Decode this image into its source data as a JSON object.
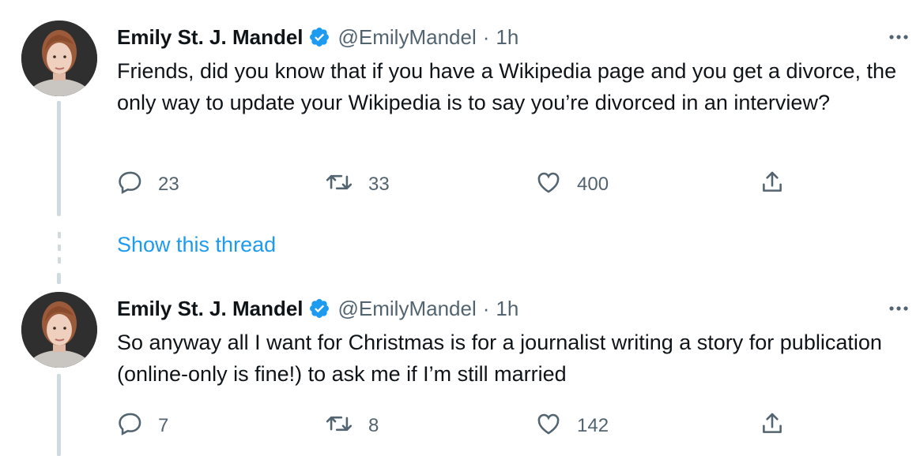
{
  "tweets": [
    {
      "author_name": "Emily St. J. Mandel",
      "handle": "@EmilyMandel",
      "separator": "·",
      "time": "1h",
      "text": "Friends, did you know that if you have a Wikipedia page and you get a divorce, the only way to update your Wikipedia is to say you’re divorced in an interview?",
      "replies": "23",
      "retweets": "33",
      "likes": "400"
    },
    {
      "author_name": "Emily St. J. Mandel",
      "handle": "@EmilyMandel",
      "separator": "·",
      "time": "1h",
      "text": "So anyway all I want for Christmas is for a journalist writing a story for publication (online-only is fine!) to ask me if I’m still married",
      "replies": "7",
      "retweets": "8",
      "likes": "142"
    }
  ],
  "show_thread_label": "Show this thread",
  "colors": {
    "accent": "#1d9bf0",
    "text": "#0f1419",
    "muted": "#536471",
    "thread_line": "#cfd9de"
  },
  "icons": [
    "verified-badge-icon",
    "more-icon",
    "reply-icon",
    "retweet-icon",
    "like-icon",
    "share-icon"
  ]
}
